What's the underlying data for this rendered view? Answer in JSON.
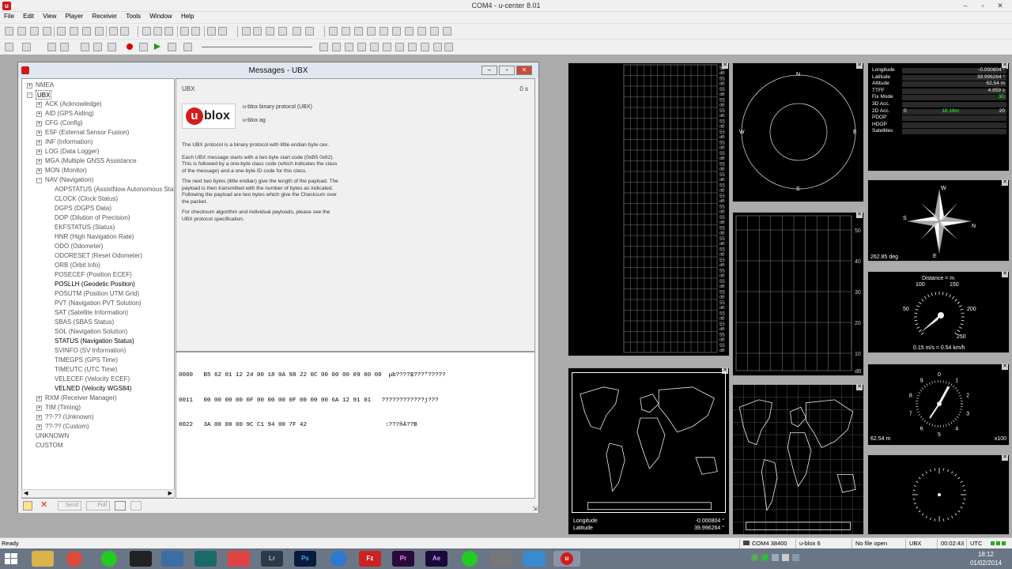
{
  "app": {
    "title": "COM4 - u-center 8.01",
    "icon": "u"
  },
  "menu": [
    "File",
    "Edit",
    "View",
    "Player",
    "Receiver",
    "Tools",
    "Window",
    "Help"
  ],
  "messages_window": {
    "title": "Messages - UBX",
    "tree": [
      {
        "label": "NMEA",
        "level": 0,
        "expand": "+"
      },
      {
        "label": "UBX",
        "level": 0,
        "expand": "-",
        "bold": true
      },
      {
        "label": "ACK (Acknowledge)",
        "level": 1,
        "expand": "+"
      },
      {
        "label": "AID (GPS Aiding)",
        "level": 1,
        "expand": "+"
      },
      {
        "label": "CFG (Config)",
        "level": 1,
        "expand": "+"
      },
      {
        "label": "ESF (External Sensor Fusion)",
        "level": 1,
        "expand": "+"
      },
      {
        "label": "INF (Information)",
        "level": 1,
        "expand": "+"
      },
      {
        "label": "LOG (Data Logger)",
        "level": 1,
        "expand": "+"
      },
      {
        "label": "MGA (Multiple GNSS Assistance",
        "level": 1,
        "expand": "+"
      },
      {
        "label": "MON (Monitor)",
        "level": 1,
        "expand": "+"
      },
      {
        "label": "NAV (Navigation)",
        "level": 1,
        "expand": "-"
      },
      {
        "label": "AOPSTATUS (AssistNow Autonomous Stat",
        "level": 2
      },
      {
        "label": "CLOCK (Clock Status)",
        "level": 2
      },
      {
        "label": "DGPS (DGPS Data)",
        "level": 2
      },
      {
        "label": "DOP (Dilution of Precision)",
        "level": 2
      },
      {
        "label": "EKFSTATUS (Status)",
        "level": 2
      },
      {
        "label": "HNR (High Navigation Rate)",
        "level": 2
      },
      {
        "label": "ODO (Odometer)",
        "level": 2
      },
      {
        "label": "ODORESET (Reset Odometer)",
        "level": 2
      },
      {
        "label": "ORB (Orbit Info)",
        "level": 2
      },
      {
        "label": "POSECEF (Position ECEF)",
        "level": 2
      },
      {
        "label": "POSLLH (Geodetic Position)",
        "level": 2,
        "bold": true
      },
      {
        "label": "POSUTM (Position UTM Grid)",
        "level": 2
      },
      {
        "label": "PVT (Navigation PVT Solution)",
        "level": 2
      },
      {
        "label": "SAT (Satellite Information)",
        "level": 2
      },
      {
        "label": "SBAS (SBAS Status)",
        "level": 2
      },
      {
        "label": "SOL (Navigation Solution)",
        "level": 2
      },
      {
        "label": "STATUS (Navigation Status)",
        "level": 2,
        "bold": true
      },
      {
        "label": "SVINFO (SV Information)",
        "level": 2
      },
      {
        "label": "TIMEGPS (GPS Time)",
        "level": 2
      },
      {
        "label": "TIMEUTC (UTC Time)",
        "level": 2
      },
      {
        "label": "VELECEF (Velocity ECEF)",
        "level": 2
      },
      {
        "label": "VELNED (Velocity WGS84)",
        "level": 2,
        "bold": true
      },
      {
        "label": "RXM (Receiver Manager)",
        "level": 1,
        "expand": "+"
      },
      {
        "label": "TIM (Timing)",
        "level": 1,
        "expand": "+"
      },
      {
        "label": "??-?? (Unknown)",
        "level": 1,
        "expand": "+"
      },
      {
        "label": "??-?? (Custom)",
        "level": 1,
        "expand": "+"
      },
      {
        "label": "UNKNOWN",
        "level": 0
      },
      {
        "label": "CUSTOM",
        "level": 0
      }
    ],
    "header_label": "UBX",
    "header_time": "0 s",
    "logo_text": "blox",
    "logo_u": "u",
    "protocol_title": "u-blox binary protocol (UBX)",
    "company": "u-blox ag",
    "paragraphs": [
      "The UBX protocol is a binary protocol with little endian byte cex.",
      "Each UBX message starts with a two byte start code (0xB5 0x62). This is followed by a one-byte class code (which indicates the class of the message) and a one-byte ID code for this class.",
      "The next two bytes (little endian) give the length of the payload. The payload is then transmitted with the number of bytes as indicated. Following the payload are two bytes which give the Checksum over the packet.",
      "For checksum algorithm and individual payloads, please see the UBX protocol specification."
    ],
    "hex_rows": [
      {
        "offset": "0000",
        "bytes": "B5 62 01 12 24 00 18 0A 98 22 0C 00 00 00 09 00 00",
        "ascii": "µb????$???\"?????"
      },
      {
        "offset": "0011",
        "bytes": "00 00 00 00 0F 00 00 00 0F 00 00 00 6A 12 91 01",
        "ascii": "????????????j???"
      },
      {
        "offset": "0022",
        "bytes": "3A 00 00 00 9C C1 94 00 7F 42",
        "ascii": ":???ñÁ??B"
      }
    ],
    "footer_buttons": [
      "Send",
      "Poll"
    ]
  },
  "panels": {
    "sky_labels": {
      "n": "N",
      "e": "E",
      "s": "S",
      "w": "W"
    },
    "signal_unit": "dB",
    "signal_ticks": [
      "55",
      "55",
      "55",
      "55",
      "55",
      "55",
      "55",
      "55",
      "55",
      "55",
      "55",
      "55",
      "55",
      "55",
      "55",
      "55",
      "55",
      "55",
      "55",
      "55",
      "55",
      "55",
      "55",
      "55",
      "55",
      "55",
      "55"
    ],
    "level_ticks": [
      "50",
      "40",
      "30",
      "20",
      "10"
    ],
    "level_unit": "dB",
    "data_rows": [
      {
        "label": "Longitude",
        "value": "-0.000804 °"
      },
      {
        "label": "Latitude",
        "value": "39.996264 °"
      },
      {
        "label": "Altitude",
        "value": "62.54 m"
      },
      {
        "label": "TTFF",
        "value": "4.859 s"
      },
      {
        "label": "Fix Mode",
        "value": "3D"
      },
      {
        "label": "3D Acc.",
        "value": ""
      },
      {
        "label": "2D Acc.",
        "value": "18.18m",
        "min": "0",
        "max": "20"
      },
      {
        "label": "PDOP",
        "value": ""
      },
      {
        "label": "HDOP",
        "value": ""
      },
      {
        "label": "Satellites",
        "value": ""
      }
    ],
    "compass": {
      "heading": "262.85 deg",
      "n": "W",
      "s": "E",
      "e": "N",
      "w": "S"
    },
    "speed": {
      "title": "Distance = m",
      "readout": "0.15 m/s = 0.54 km/h",
      "ticks": [
        "100",
        "150",
        "200",
        "250",
        "50"
      ]
    },
    "altimeter": {
      "left": "62.54 m",
      "right": "x100",
      "ticks": [
        "0",
        "1",
        "2",
        "3",
        "4",
        "5",
        "6",
        "7",
        "8",
        "9"
      ]
    },
    "map1": {
      "lon_label": "Longitude",
      "lon_value": "-0.000804 °",
      "lat_label": "Latitude",
      "lat_value": "39.996264 °"
    }
  },
  "statusbar": {
    "ready": "Ready",
    "port": "COM4 38400",
    "receiver": "u-blox 6",
    "file": "No file open",
    "protocol": "UBX",
    "time": "00:02:43",
    "tz": "UTC"
  },
  "taskbar": {
    "time": "18:12",
    "date": "01/02/2014",
    "apps": [
      "Lr",
      "Ps",
      "Pr",
      "Ae",
      "Fz"
    ]
  }
}
